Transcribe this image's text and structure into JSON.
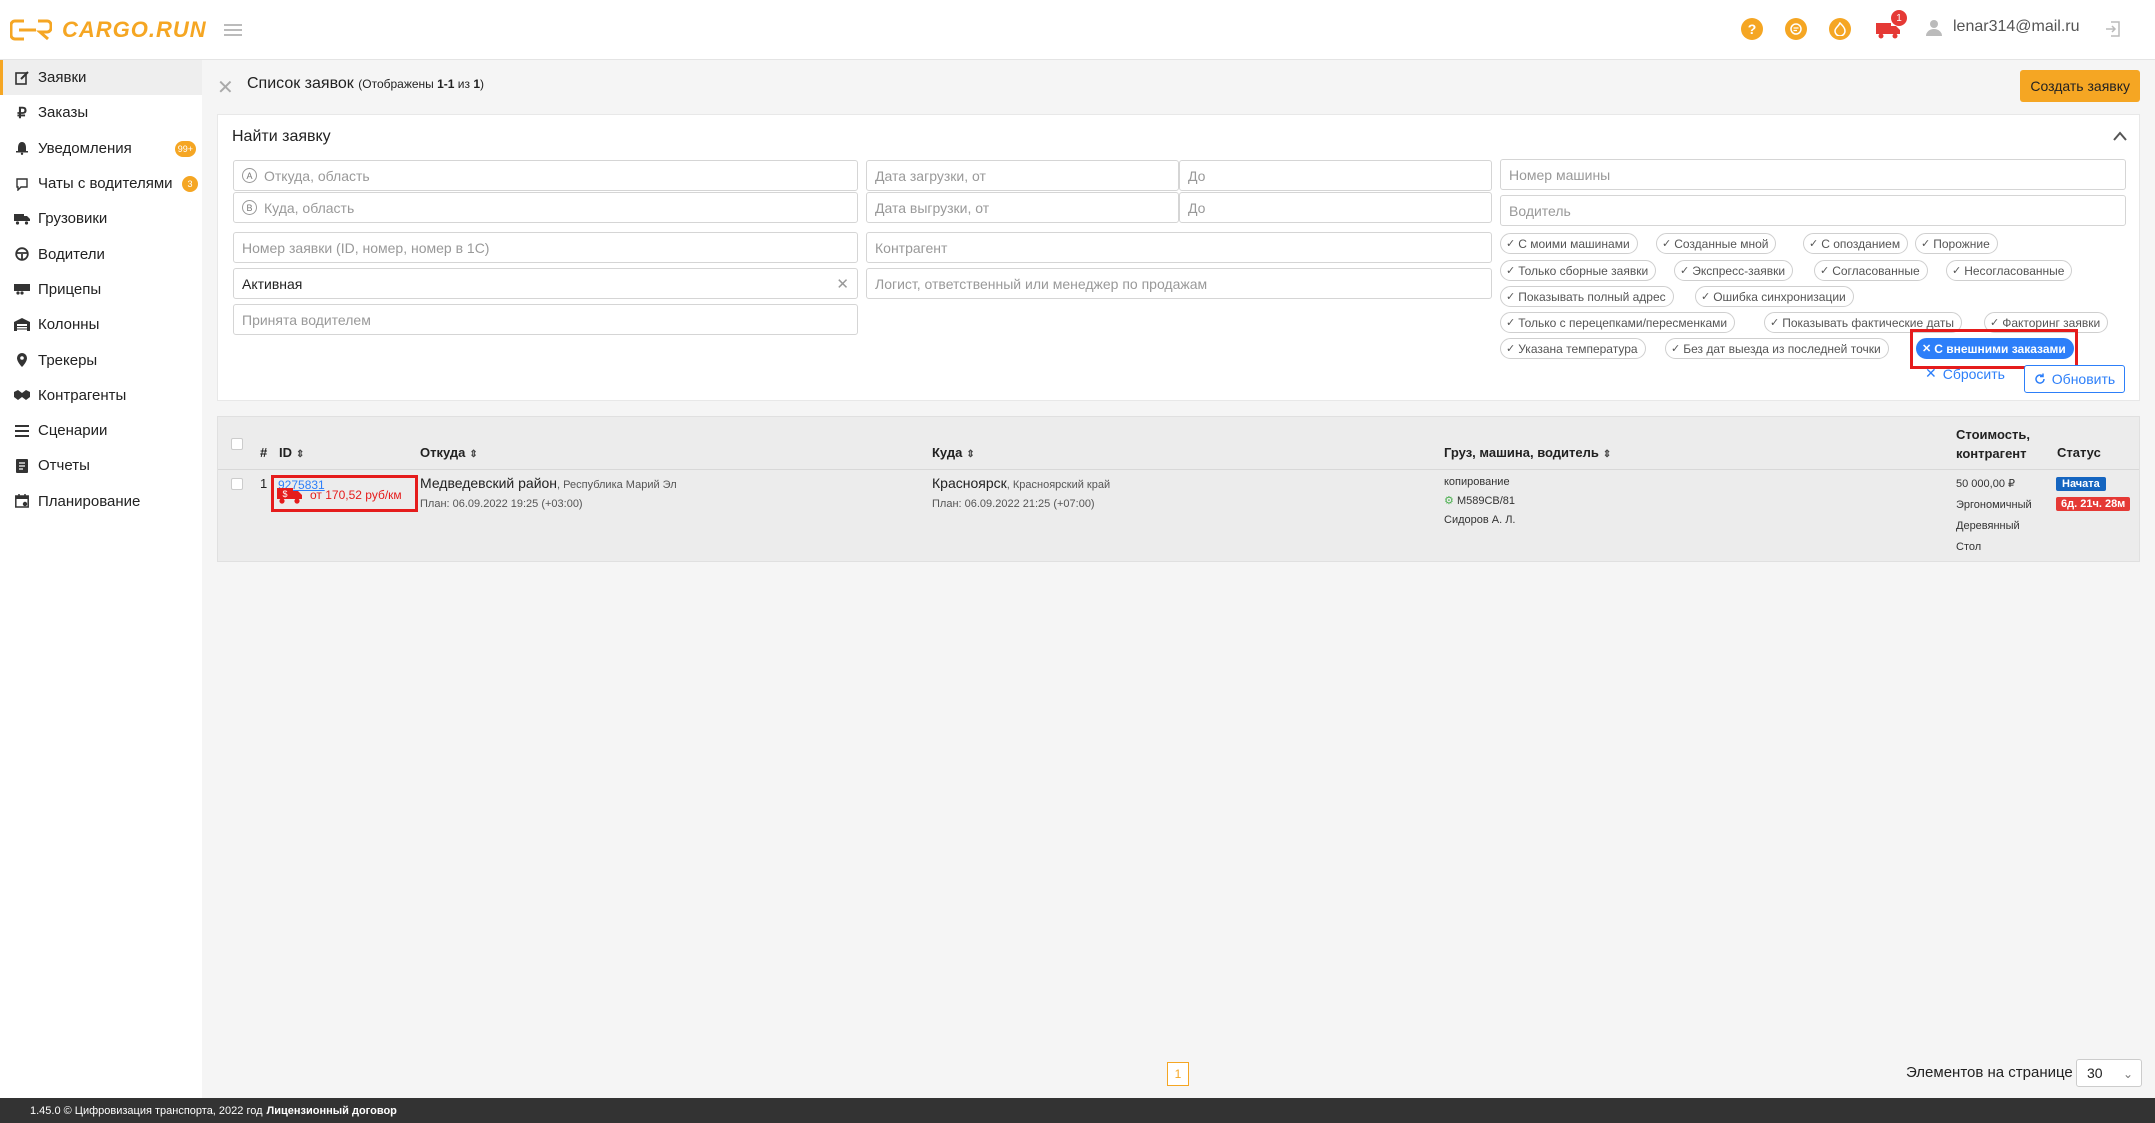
{
  "app": {
    "logo_text": "CARGO.RUN",
    "user_email": "lenar314@mail.ru",
    "truck_badge": "1"
  },
  "sidebar": {
    "items": [
      {
        "label": "Заявки",
        "icon": "edit-icon",
        "active": true
      },
      {
        "label": "Заказы",
        "icon": "ruble-icon"
      },
      {
        "label": "Уведомления",
        "icon": "bell-icon",
        "badge": "99+"
      },
      {
        "label": "Чаты с водителями",
        "icon": "chat-icon",
        "badge": "3"
      },
      {
        "label": "Грузовики",
        "icon": "truck-icon"
      },
      {
        "label": "Водители",
        "icon": "steering-wheel-icon"
      },
      {
        "label": "Прицепы",
        "icon": "trailer-icon"
      },
      {
        "label": "Колонны",
        "icon": "warehouse-icon"
      },
      {
        "label": "Трекеры",
        "icon": "map-pin-icon"
      },
      {
        "label": "Контрагенты",
        "icon": "handshake-icon"
      },
      {
        "label": "Сценарии",
        "icon": "list-icon"
      },
      {
        "label": "Отчеты",
        "icon": "report-icon"
      },
      {
        "label": "Планирование",
        "icon": "calendar-icon"
      }
    ]
  },
  "header": {
    "title": "Список заявок",
    "subtitle_prefix": "(Отображены ",
    "shown_range": "1-1",
    "of_text": " из ",
    "total": "1",
    "subtitle_suffix": ")",
    "create_button": "Создать заявку"
  },
  "filters": {
    "title": "Найти заявку",
    "from_placeholder": "Откуда, область",
    "from_marker": "A",
    "to_placeholder": "Куда, область",
    "to_marker": "B",
    "load_date_from": "Дата загрузки, от",
    "load_date_to": "До",
    "unload_date_from": "Дата выгрузки, от",
    "unload_date_to": "До",
    "vehicle_number": "Номер машины",
    "driver": "Водитель",
    "order_number": "Номер заявки (ID, номер, номер в 1С)",
    "counterparty": "Контрагент",
    "status_value": "Активная",
    "logist": "Логист, ответственный или менеджер по продажам",
    "accepted_by_driver": "Принята водителем",
    "chips": [
      "С моими машинами",
      "Созданные мной",
      "С опозданием",
      "Порожние",
      "Только сборные заявки",
      "Экспресс-заявки",
      "Согласованные",
      "Несогласованные",
      "Показывать полный адрес",
      "Ошибка синхронизации",
      "Только с перецепками/пересменками",
      "Показывать фактические даты",
      "Факторинг заявки",
      "Указана температура",
      "Без дат выезда из последней точки"
    ],
    "active_chip": "С внешними заказами",
    "reset_button": "Сбросить",
    "refresh_button": "Обновить"
  },
  "table": {
    "headers": {
      "num": "#",
      "id": "ID",
      "from": "Откуда",
      "to": "Куда",
      "cargo": "Груз, машина, водитель",
      "cost_line1": "Стоимость,",
      "cost_line2": "контрагент",
      "status": "Статус"
    },
    "rows": [
      {
        "num": "1",
        "id": "9275831",
        "price_per_km": "от 170,52 руб/км",
        "from_city": "Медведевский район",
        "from_region": ", Республика Марий Эл",
        "from_plan": "План: 06.09.2022 19:25 (+03:00)",
        "to_city": "Красноярск",
        "to_region": ", Красноярский край",
        "to_plan": "План: 06.09.2022 21:25 (+07:00)",
        "cargo": "копирование",
        "vehicle": "М589СВ/81",
        "driver": "Сидоров А. Л.",
        "cost": "50 000,00 ₽",
        "counterparty_1": "Эргономичный",
        "counterparty_2": "Деревянный",
        "counterparty_3": "Стол",
        "status": "Начата",
        "status_time": "6д. 21ч. 28м"
      }
    ]
  },
  "pagination": {
    "current_page": "1",
    "per_page_label": "Элементов на странице",
    "per_page_value": "30"
  },
  "footer": {
    "text": "1.45.0 © Цифровизация транспорта, 2022 год",
    "link": "Лицензионный договор"
  },
  "colors": {
    "accent": "#f5a623",
    "primary": "#2d7ff9",
    "danger": "#e51c1c"
  }
}
